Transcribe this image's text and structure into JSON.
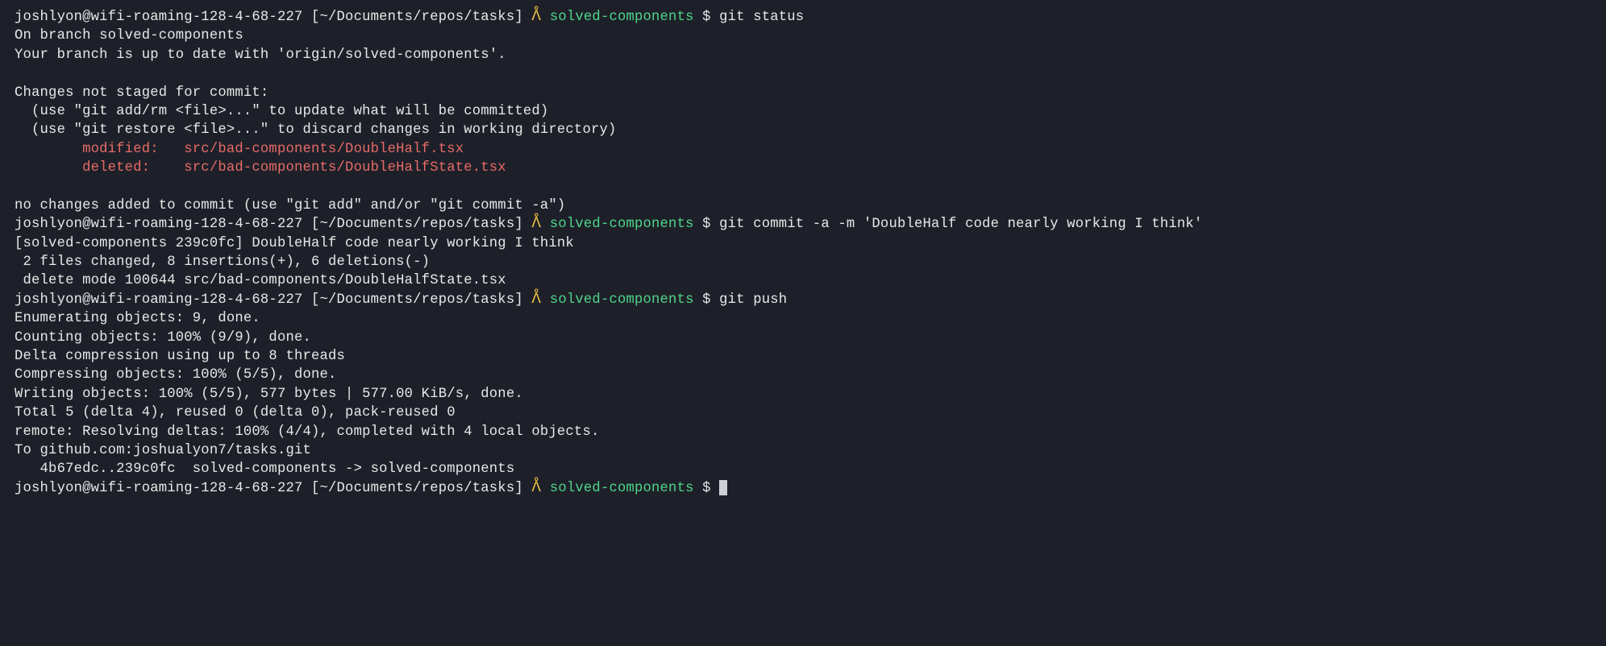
{
  "prompt": {
    "user": "joshlyon",
    "host": "wifi-roaming-128-4-68-227",
    "path": "~/Documents/repos/tasks",
    "lambda": "ᐰ",
    "branch": "solved-components",
    "dollar": "$"
  },
  "entries": [
    {
      "cmd": "git status",
      "out": [
        {
          "t": "On branch solved-components"
        },
        {
          "t": "Your branch is up to date with 'origin/solved-components'."
        },
        {
          "t": ""
        },
        {
          "t": "Changes not staged for commit:"
        },
        {
          "t": "  (use \"git add/rm <file>...\" to update what will be committed)"
        },
        {
          "t": "  (use \"git restore <file>...\" to discard changes in working directory)"
        },
        {
          "t": "        modified:   src/bad-components/DoubleHalf.tsx",
          "cls": "red"
        },
        {
          "t": "        deleted:    src/bad-components/DoubleHalfState.tsx",
          "cls": "red"
        },
        {
          "t": ""
        },
        {
          "t": "no changes added to commit (use \"git add\" and/or \"git commit -a\")"
        }
      ]
    },
    {
      "cmd": "git commit -a -m 'DoubleHalf code nearly working I think'",
      "out": [
        {
          "t": "[solved-components 239c0fc] DoubleHalf code nearly working I think"
        },
        {
          "t": " 2 files changed, 8 insertions(+), 6 deletions(-)"
        },
        {
          "t": " delete mode 100644 src/bad-components/DoubleHalfState.tsx"
        }
      ]
    },
    {
      "cmd": "git push",
      "out": [
        {
          "t": "Enumerating objects: 9, done."
        },
        {
          "t": "Counting objects: 100% (9/9), done."
        },
        {
          "t": "Delta compression using up to 8 threads"
        },
        {
          "t": "Compressing objects: 100% (5/5), done."
        },
        {
          "t": "Writing objects: 100% (5/5), 577 bytes | 577.00 KiB/s, done."
        },
        {
          "t": "Total 5 (delta 4), reused 0 (delta 0), pack-reused 0"
        },
        {
          "t": "remote: Resolving deltas: 100% (4/4), completed with 4 local objects."
        },
        {
          "t": "To github.com:joshualyon7/tasks.git"
        },
        {
          "t": "   4b67edc..239c0fc  solved-components -> solved-components"
        }
      ]
    },
    {
      "cmd": "",
      "out": [],
      "cursor": true
    }
  ]
}
